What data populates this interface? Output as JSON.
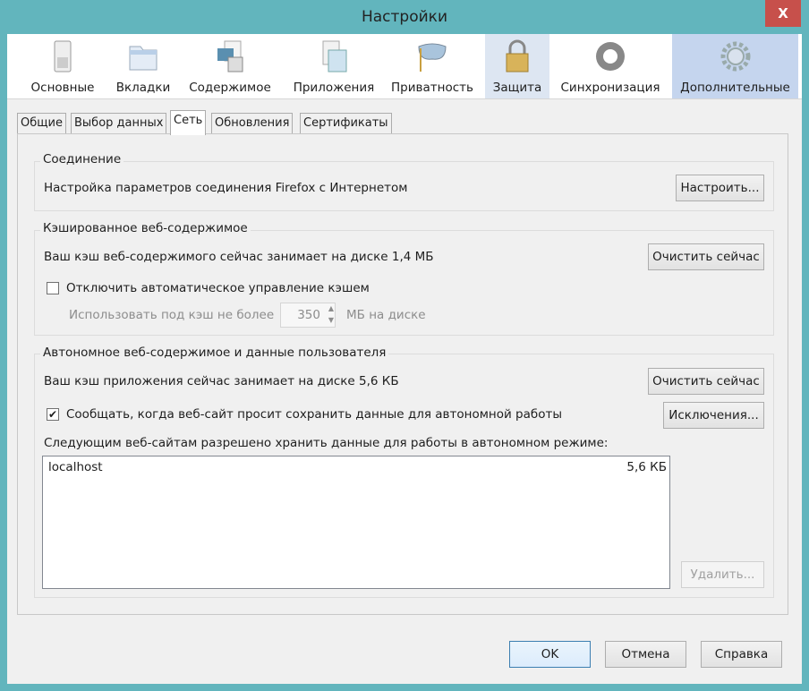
{
  "window": {
    "title": "Настройки",
    "close_label": "X"
  },
  "panes": [
    {
      "label": "Основные"
    },
    {
      "label": "Вкладки"
    },
    {
      "label": "Содержимое"
    },
    {
      "label": "Приложения"
    },
    {
      "label": "Приватность"
    },
    {
      "label": "Защита"
    },
    {
      "label": "Синхронизация"
    },
    {
      "label": "Дополнительные"
    }
  ],
  "tabs": [
    {
      "label": "Общие"
    },
    {
      "label": "Выбор данных"
    },
    {
      "label": "Сеть"
    },
    {
      "label": "Обновления"
    },
    {
      "label": "Сертификаты"
    }
  ],
  "connection": {
    "title": "Соединение",
    "text": "Настройка параметров соединения Firefox с Интернетом",
    "button": "Настроить..."
  },
  "cache": {
    "title": "Кэшированное веб-содержимое",
    "text": "Ваш кэш веб-содержимого сейчас занимает на диске 1,4 МБ",
    "button": "Очистить сейчас",
    "override_label": "Отключить автоматическое управление кэшем",
    "override_checked": false,
    "limit_label": "Использовать под кэш не более",
    "limit_value": "350",
    "limit_unit": "МБ на диске"
  },
  "offline": {
    "title": "Автономное веб-содержимое и данные пользователя",
    "text": "Ваш кэш приложения сейчас занимает на диске 5,6 КБ",
    "button": "Очистить сейчас",
    "notify_label": "Сообщать, когда веб-сайт просит сохранить данные для автономной работы",
    "notify_checked": true,
    "exceptions_button": "Исключения...",
    "list_label": "Следующим веб-сайтам разрешено хранить данные для работы в автономном режиме:",
    "sites": [
      {
        "name": "localhost",
        "size": "5,6 КБ"
      }
    ],
    "remove_button": "Удалить..."
  },
  "footer": {
    "ok": "OK",
    "cancel": "Отмена",
    "help": "Справка"
  },
  "colors": {
    "titlebar": "#62b5bd",
    "close": "#c7504b",
    "selected_pane": "#c5d5ee"
  }
}
